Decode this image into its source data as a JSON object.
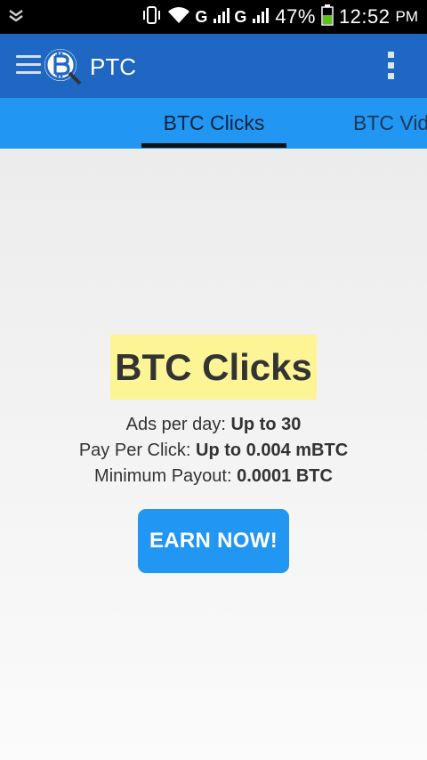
{
  "status_bar": {
    "network_1": "G",
    "network_2": "G",
    "battery_percent": "47%",
    "time": "12:52",
    "time_suffix": "PM"
  },
  "app_bar": {
    "title": "PTC"
  },
  "tabs": [
    {
      "label": "BTC Clicks",
      "active": true
    },
    {
      "label": "BTC Videos",
      "active": false
    }
  ],
  "card": {
    "title": "BTC Clicks",
    "lines": [
      {
        "label": "Ads per day: ",
        "value": "Up to 30"
      },
      {
        "label": "Pay Per Click: ",
        "value": "Up to 0.004 mBTC"
      },
      {
        "label": "Minimum Payout: ",
        "value": "0.0001 BTC"
      }
    ],
    "button_label": "EARN NOW!"
  },
  "colors": {
    "status_bar": "#000000",
    "app_bar": "#1f67c2",
    "tab_bar": "#2196f3",
    "title_highlight": "#fdf495",
    "button": "#2196f3"
  }
}
